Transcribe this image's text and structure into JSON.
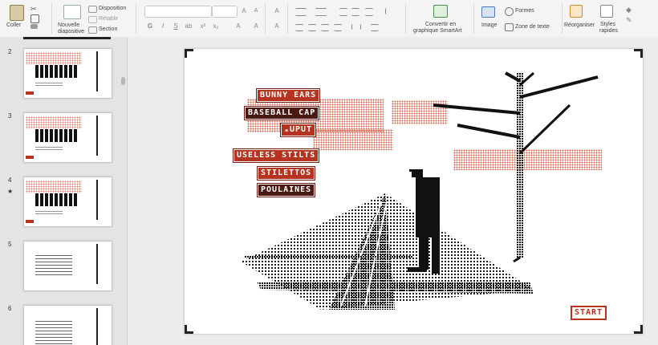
{
  "ribbon": {
    "paste_label": "Coller",
    "new_slide_label": [
      "Nouvelle",
      "diapositive"
    ],
    "layout_label": "Disposition",
    "reset_label": "Rétablir",
    "section_label": "Section",
    "convert_smartart_label": [
      "Convertir en",
      "graphique SmartArt"
    ],
    "image_label": "Image",
    "shapes_label": "Formes",
    "textbox_label": "Zone de texte",
    "arrange_label": "Réorganiser",
    "quick_styles_label": [
      "Styles",
      "rapides"
    ],
    "format_buttons": [
      "G",
      "I",
      "S",
      "ab",
      "x²",
      "x₂",
      "A",
      "A"
    ]
  },
  "thumbnails": [
    {
      "number": "2",
      "type": "title"
    },
    {
      "number": "3",
      "type": "title"
    },
    {
      "number": "4",
      "type": "title",
      "starred": true
    },
    {
      "number": "5",
      "type": "text"
    },
    {
      "number": "6",
      "type": "text"
    }
  ],
  "slide": {
    "menu_items": [
      {
        "label": "BUNNY EARS",
        "color": "#b5331f"
      },
      {
        "label": "BASEBALL CAP",
        "color": "#4a1a12"
      },
      {
        "label": "ₐUPUT",
        "color": "#b5331f"
      },
      {
        "label": "USELESS STILTS",
        "color": "#b5331f"
      },
      {
        "label": "STILETTOS",
        "color": "#b5331f"
      },
      {
        "label": "POULAINES",
        "color": "#4a1a12"
      }
    ],
    "start_label": "START"
  }
}
